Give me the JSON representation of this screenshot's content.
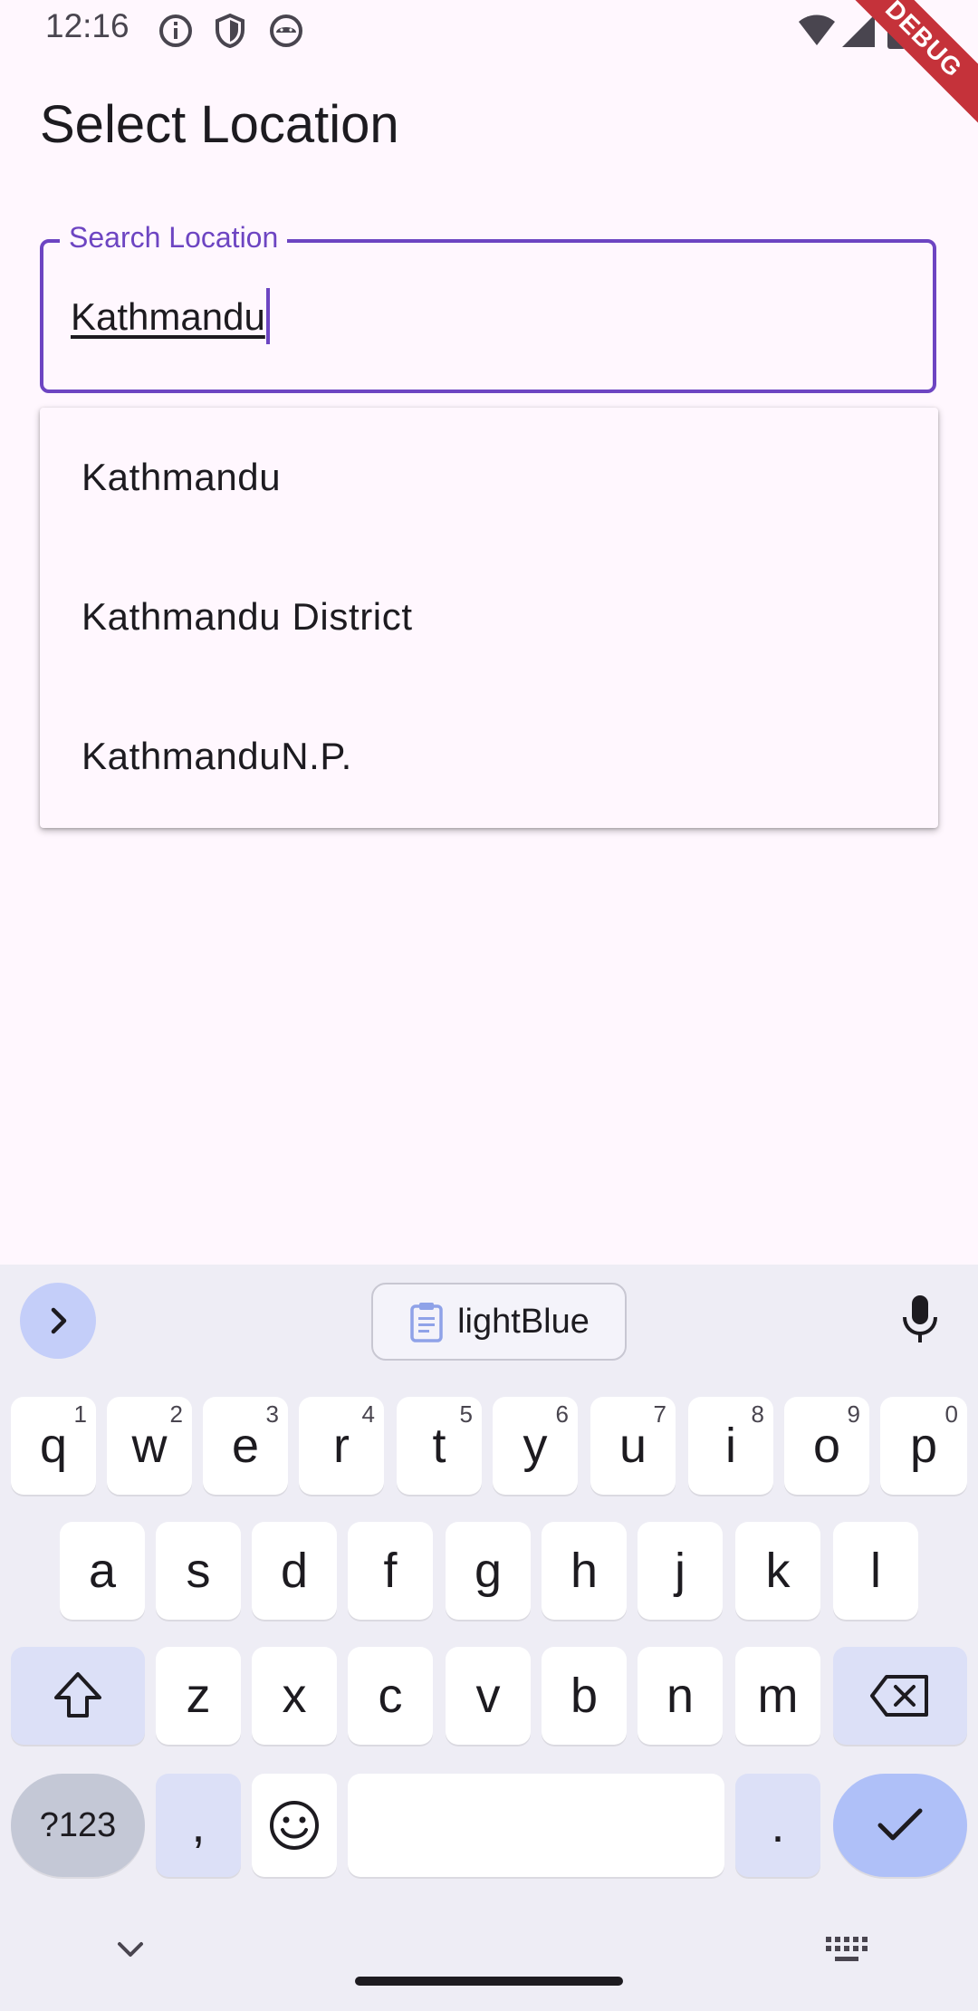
{
  "status_bar": {
    "time": "12:16",
    "icons": [
      "info-icon",
      "shield-icon",
      "android-icon",
      "wifi-icon",
      "signal-icon",
      "battery-icon"
    ],
    "debug_label": "DEBUG"
  },
  "page": {
    "title": "Select Location"
  },
  "search": {
    "label": "Search Location",
    "value": "Kathmandu"
  },
  "dropdown": {
    "options": [
      {
        "label": "Kathmandu"
      },
      {
        "label": "Kathmandu District"
      },
      {
        "label": "KathmanduN.P."
      }
    ]
  },
  "keyboard": {
    "suggestion": "lightBlue",
    "row1": [
      {
        "key": "q",
        "hint": "1"
      },
      {
        "key": "w",
        "hint": "2"
      },
      {
        "key": "e",
        "hint": "3"
      },
      {
        "key": "r",
        "hint": "4"
      },
      {
        "key": "t",
        "hint": "5"
      },
      {
        "key": "y",
        "hint": "6"
      },
      {
        "key": "u",
        "hint": "7"
      },
      {
        "key": "i",
        "hint": "8"
      },
      {
        "key": "o",
        "hint": "9"
      },
      {
        "key": "p",
        "hint": "0"
      }
    ],
    "row2": [
      "a",
      "s",
      "d",
      "f",
      "g",
      "h",
      "j",
      "k",
      "l"
    ],
    "row3": [
      "z",
      "x",
      "c",
      "v",
      "b",
      "n",
      "m"
    ],
    "symbols_key": "?123",
    "comma_key": ",",
    "period_key": ".",
    "colors": {
      "accent": "#6D45C2",
      "function_key": "#DCE0F7",
      "enter_key": "#AFC0F8"
    }
  }
}
